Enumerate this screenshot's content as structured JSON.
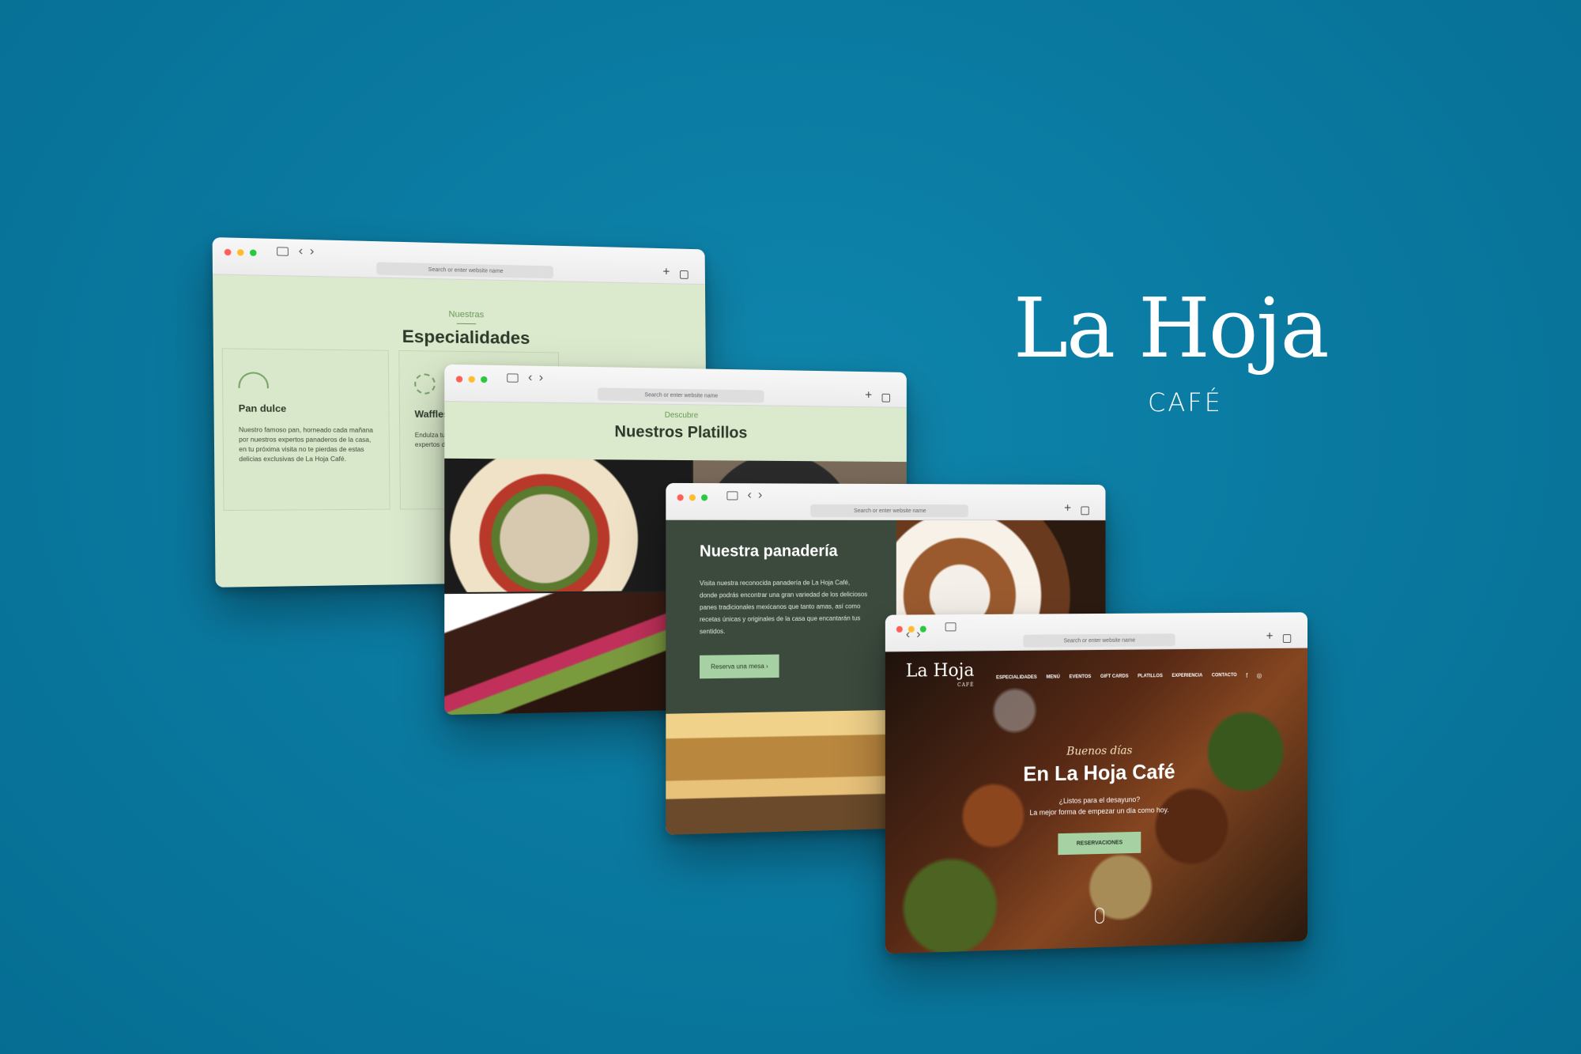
{
  "brand": {
    "name": "La Hoja",
    "subtitle": "CAFÉ"
  },
  "browser": {
    "url_placeholder": "Search or enter website name"
  },
  "especialidades": {
    "eyebrow": "Nuestras",
    "heading": "Especialidades",
    "cards": [
      {
        "title": "Pan dulce",
        "description": "Nuestro famoso pan, horneado cada mañana por nuestros expertos panaderos de la casa, en tu próxima visita no te pierdas de estas delicias exclusivas de La Hoja Café."
      },
      {
        "title": "Waffles y",
        "description": "Endulza tu pa delicioso pla chuparte los expertos del"
      }
    ]
  },
  "platillos": {
    "eyebrow": "Descubre",
    "heading": "Nuestros Platillos"
  },
  "panaderia": {
    "heading": "Nuestra panadería",
    "body": "Visita nuestra reconocida panadería de La Hoja Café, donde podrás encontrar una gran variedad de los deliciosos panes tradicionales mexicanos que tanto amas, así como recetas únicas y originales de la casa que encantarán tus sentidos.",
    "button": "Reserva una mesa  ›"
  },
  "home": {
    "logo": "La Hoja",
    "logo_sub": "CAFÉ",
    "nav": [
      "ESPECIALIDADES",
      "MENÚ",
      "EVENTOS",
      "GIFT CARDS",
      "PLATILLOS",
      "EXPERIENCIA",
      "CONTACTO"
    ],
    "social": [
      "f",
      "◎"
    ],
    "script": "Buenos días",
    "title": "En La Hoja Café",
    "subtitle_1": "¿Listos para el desayuno?",
    "subtitle_2": "La mejor forma de empezar un día como hoy.",
    "cta": "RESERVACIONES"
  }
}
